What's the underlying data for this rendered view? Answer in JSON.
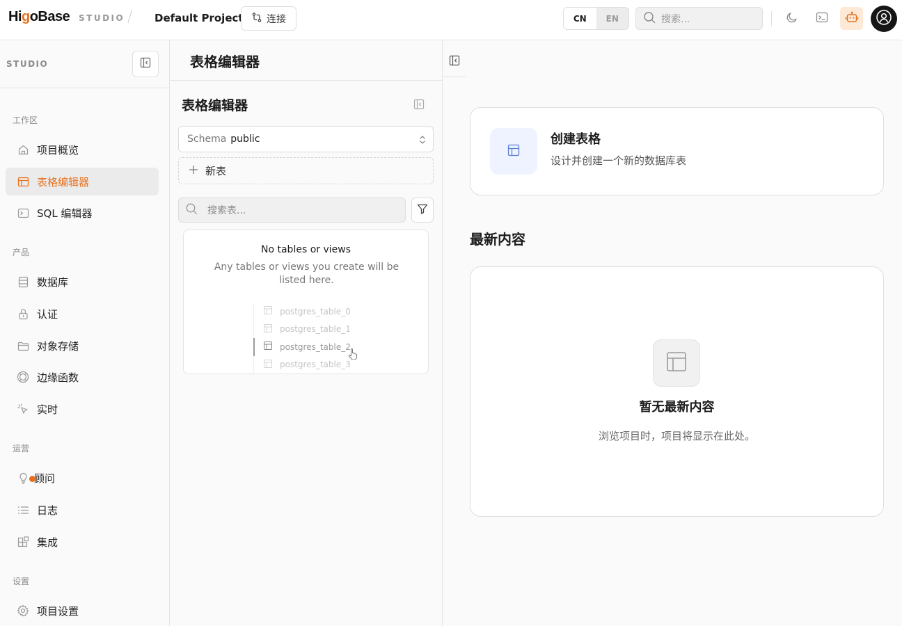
{
  "topbar": {
    "logo_prefix": "Hi",
    "logo_accent": "g",
    "logo_suffix": "oBase",
    "studio_tag": "STUDIO",
    "separator": "/",
    "project_name": "Default Project",
    "connect_label": "连接",
    "lang_cn": "CN",
    "lang_en": "EN",
    "active_lang": "CN",
    "search_placeholder": "搜索...",
    "icons": [
      "moon-icon",
      "terminal-icon",
      "assistant-bot-icon",
      "user-avatar-icon"
    ]
  },
  "sidebar": {
    "header_label": "STUDIO",
    "sections": {
      "workspace": "工作区",
      "product": "产品",
      "operations": "运营",
      "settings": "设置"
    },
    "items": {
      "overview": "项目概览",
      "table_editor": "表格编辑器",
      "sql_editor": "SQL 编辑器",
      "database": "数据库",
      "auth": "认证",
      "storage": "对象存储",
      "edge_functions": "边缘函数",
      "realtime": "实时",
      "advisor": "顾问",
      "logs": "日志",
      "integrations": "集成",
      "project_settings": "项目设置"
    },
    "active_item": "table_editor"
  },
  "middle": {
    "header_title": "表格编辑器",
    "panel_title": "表格编辑器",
    "schema_label": "Schema",
    "schema_value": "public",
    "new_table_label": "新表",
    "search_placeholder": "搜索表...",
    "empty_title": "No tables or views",
    "empty_desc": "Any tables or views you create will be listed here.",
    "ghost_tables": [
      "postgres_table_0",
      "postgres_table_1",
      "postgres_table_2",
      "postgres_table_3"
    ]
  },
  "right": {
    "create_title": "创建表格",
    "create_desc": "设计并创建一个新的数据库表",
    "recent_title": "最新内容",
    "recent_empty_title": "暂无最新内容",
    "recent_empty_desc": "浏览项目时，项目将显示在此处。"
  },
  "colors": {
    "accent": "#e8701d",
    "create_icon_bg": "#eef3ff",
    "create_icon_fg": "#5b7fd6"
  }
}
